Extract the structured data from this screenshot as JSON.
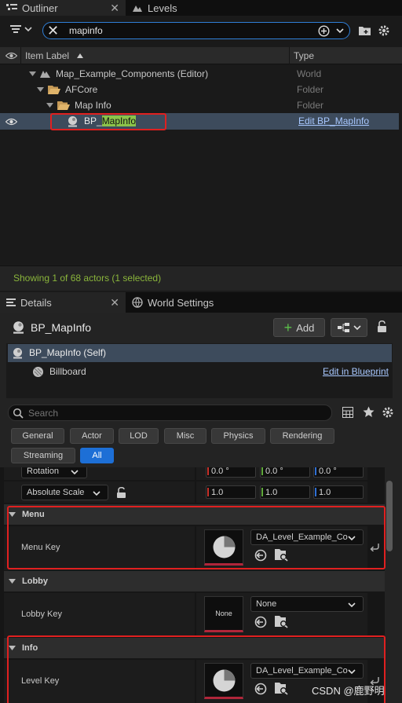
{
  "outliner_tabs": [
    {
      "label": "Outliner"
    },
    {
      "label": "Levels"
    }
  ],
  "search": {
    "value": "mapinfo"
  },
  "columns": {
    "label": "Item Label",
    "type": "Type"
  },
  "tree": [
    {
      "label": "Map_Example_Components (Editor)",
      "type": "World"
    },
    {
      "label": "AFCore",
      "type": "Folder"
    },
    {
      "label": "Map Info",
      "type": "Folder"
    },
    {
      "label_prefix": "BP_",
      "label_highlight": "MapInfo",
      "type": "Edit BP_MapInfo"
    }
  ],
  "status": "Showing 1 of 68 actors (1 selected)",
  "details_tabs": [
    {
      "label": "Details"
    },
    {
      "label": "World Settings"
    }
  ],
  "actor": {
    "name": "BP_MapInfo",
    "add_label": "Add"
  },
  "components": [
    {
      "label": "BP_MapInfo (Self)"
    },
    {
      "label": "Billboard",
      "action": "Edit in Blueprint"
    }
  ],
  "details_search": {
    "placeholder": "Search"
  },
  "filters": [
    "General",
    "Actor",
    "LOD",
    "Misc",
    "Physics",
    "Rendering",
    "Streaming",
    "All"
  ],
  "transform": {
    "rotation_label": "Rotation",
    "rotation_values": [
      "0.0 °",
      "0.0 °",
      "0.0 °"
    ],
    "scale_label": "Absolute Scale",
    "scale_values": [
      "1.0",
      "1.0",
      "1.0"
    ]
  },
  "sections": [
    {
      "category": "Menu",
      "property": "Menu Key",
      "value": "DA_Level_Example_Co",
      "thumb": "pie"
    },
    {
      "category": "Lobby",
      "property": "Lobby Key",
      "value": "None",
      "thumb": "None"
    },
    {
      "category": "Info",
      "property": "Level Key",
      "value": "DA_Level_Example_Co",
      "thumb": "pie"
    }
  ],
  "watermark": "CSDN @鹿野明",
  "colors": {
    "accent": "#1d6fd6",
    "selection": "#3d4b5c",
    "highlight": "#8bc34a",
    "annotation": "#e02020"
  }
}
